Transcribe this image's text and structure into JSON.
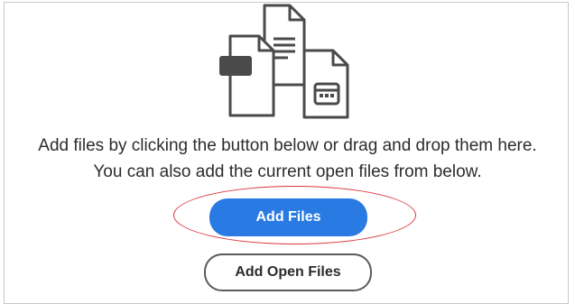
{
  "illustration": {
    "icon_name": "multiple-files-icon"
  },
  "message": {
    "line1": "Add files by clicking the button below or drag and drop them here.",
    "line2": "You can also add the current open files from below."
  },
  "buttons": {
    "add_files_label": "Add Files",
    "add_open_files_label": "Add Open Files"
  },
  "colors": {
    "primary_button": "#2a7ae3",
    "annotation_ellipse": "#d9363e",
    "text": "#2c2c2c"
  }
}
